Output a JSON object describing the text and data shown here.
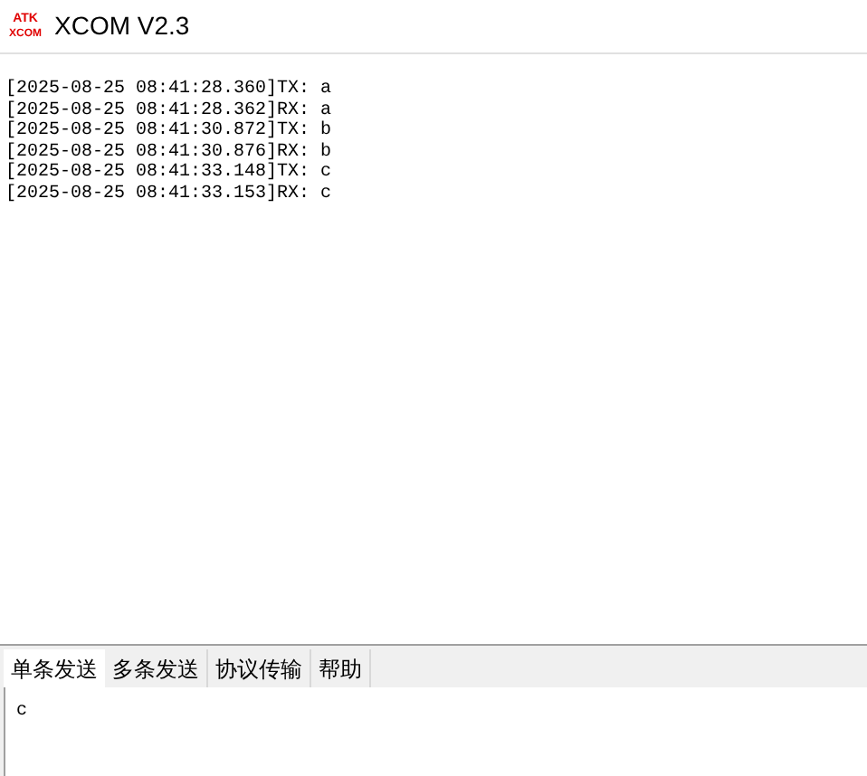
{
  "window": {
    "title": "XCOM V2.3",
    "logo": [
      "ATK",
      "XCOM"
    ]
  },
  "log": [
    "[2025-08-25 08:41:28.360]TX: a",
    "[2025-08-25 08:41:28.362]RX: a",
    "[2025-08-25 08:41:30.872]TX: b",
    "[2025-08-25 08:41:30.876]RX: b",
    "[2025-08-25 08:41:33.148]TX: c",
    "[2025-08-25 08:41:33.153]RX: c"
  ],
  "tabs": [
    {
      "label": "单条发送",
      "selected": true
    },
    {
      "label": "多条发送",
      "selected": false
    },
    {
      "label": "协议传输",
      "selected": false
    },
    {
      "label": "帮助",
      "selected": false
    }
  ],
  "send_field": {
    "value": "c"
  }
}
